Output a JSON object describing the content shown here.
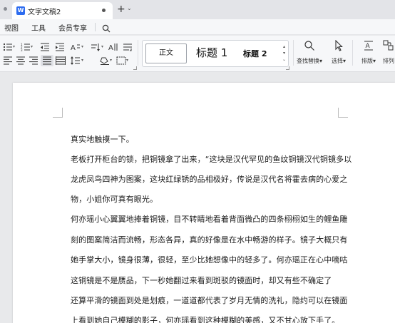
{
  "tabs": [
    {
      "title": "文字文稿2",
      "icon": "wps-writer-doc-icon",
      "active": true
    }
  ],
  "menu": [
    "视图",
    "工具",
    "会员专享"
  ],
  "ribbon": {
    "styles": {
      "normal": "正文",
      "heading1": "标题 1",
      "heading2": "标题 2"
    },
    "find_replace_label": "查找替换",
    "select_label": "选择",
    "sort_label": "排版",
    "arrange_label": "排列"
  },
  "document": {
    "lines": [
      "真实地触摸一下。",
      "老板打开柜台的锁，把铜镜拿了出来，“这块是汉代罕见的鱼纹铜镜汉代铜镜多以",
      "龙虎凤鸟四神为图案，这块红绿锈的品相极好，传说是汉代名将霍去病的心爱之",
      "物，小姐你可真有眼光。",
      "何亦瑶小心翼翼地捧着铜镜，目不转睛地看着背面微凸的四条栩栩如生的鲤鱼雕",
      "刻的图案简洁而流畅，形态各异，真的好像是在水中畅游的样子。镜子大概只有",
      "她手掌大小，镜身很薄，很轻，至少比她想像中的轻多了。何亦瑶正在心中嘀咕",
      "这铜镜是不是赝品，下一秒她翻过来看到斑驳的镜面时，却又有些不确定了",
      "还算平滑的镜面到处是划痕，一道道都代表了岁月无情的洗礼，隐约可以在镜面",
      "上看到她自己模糊的影子，何亦瑶看到这种模糊的美感，又不甘心放下手了。"
    ]
  },
  "colors": {
    "accent": "#2d6cf0",
    "titlebar": "#e3e4e8",
    "ribbon": "#f6f7f9",
    "canvas": "#e8e9eb",
    "page": "#ffffff"
  }
}
